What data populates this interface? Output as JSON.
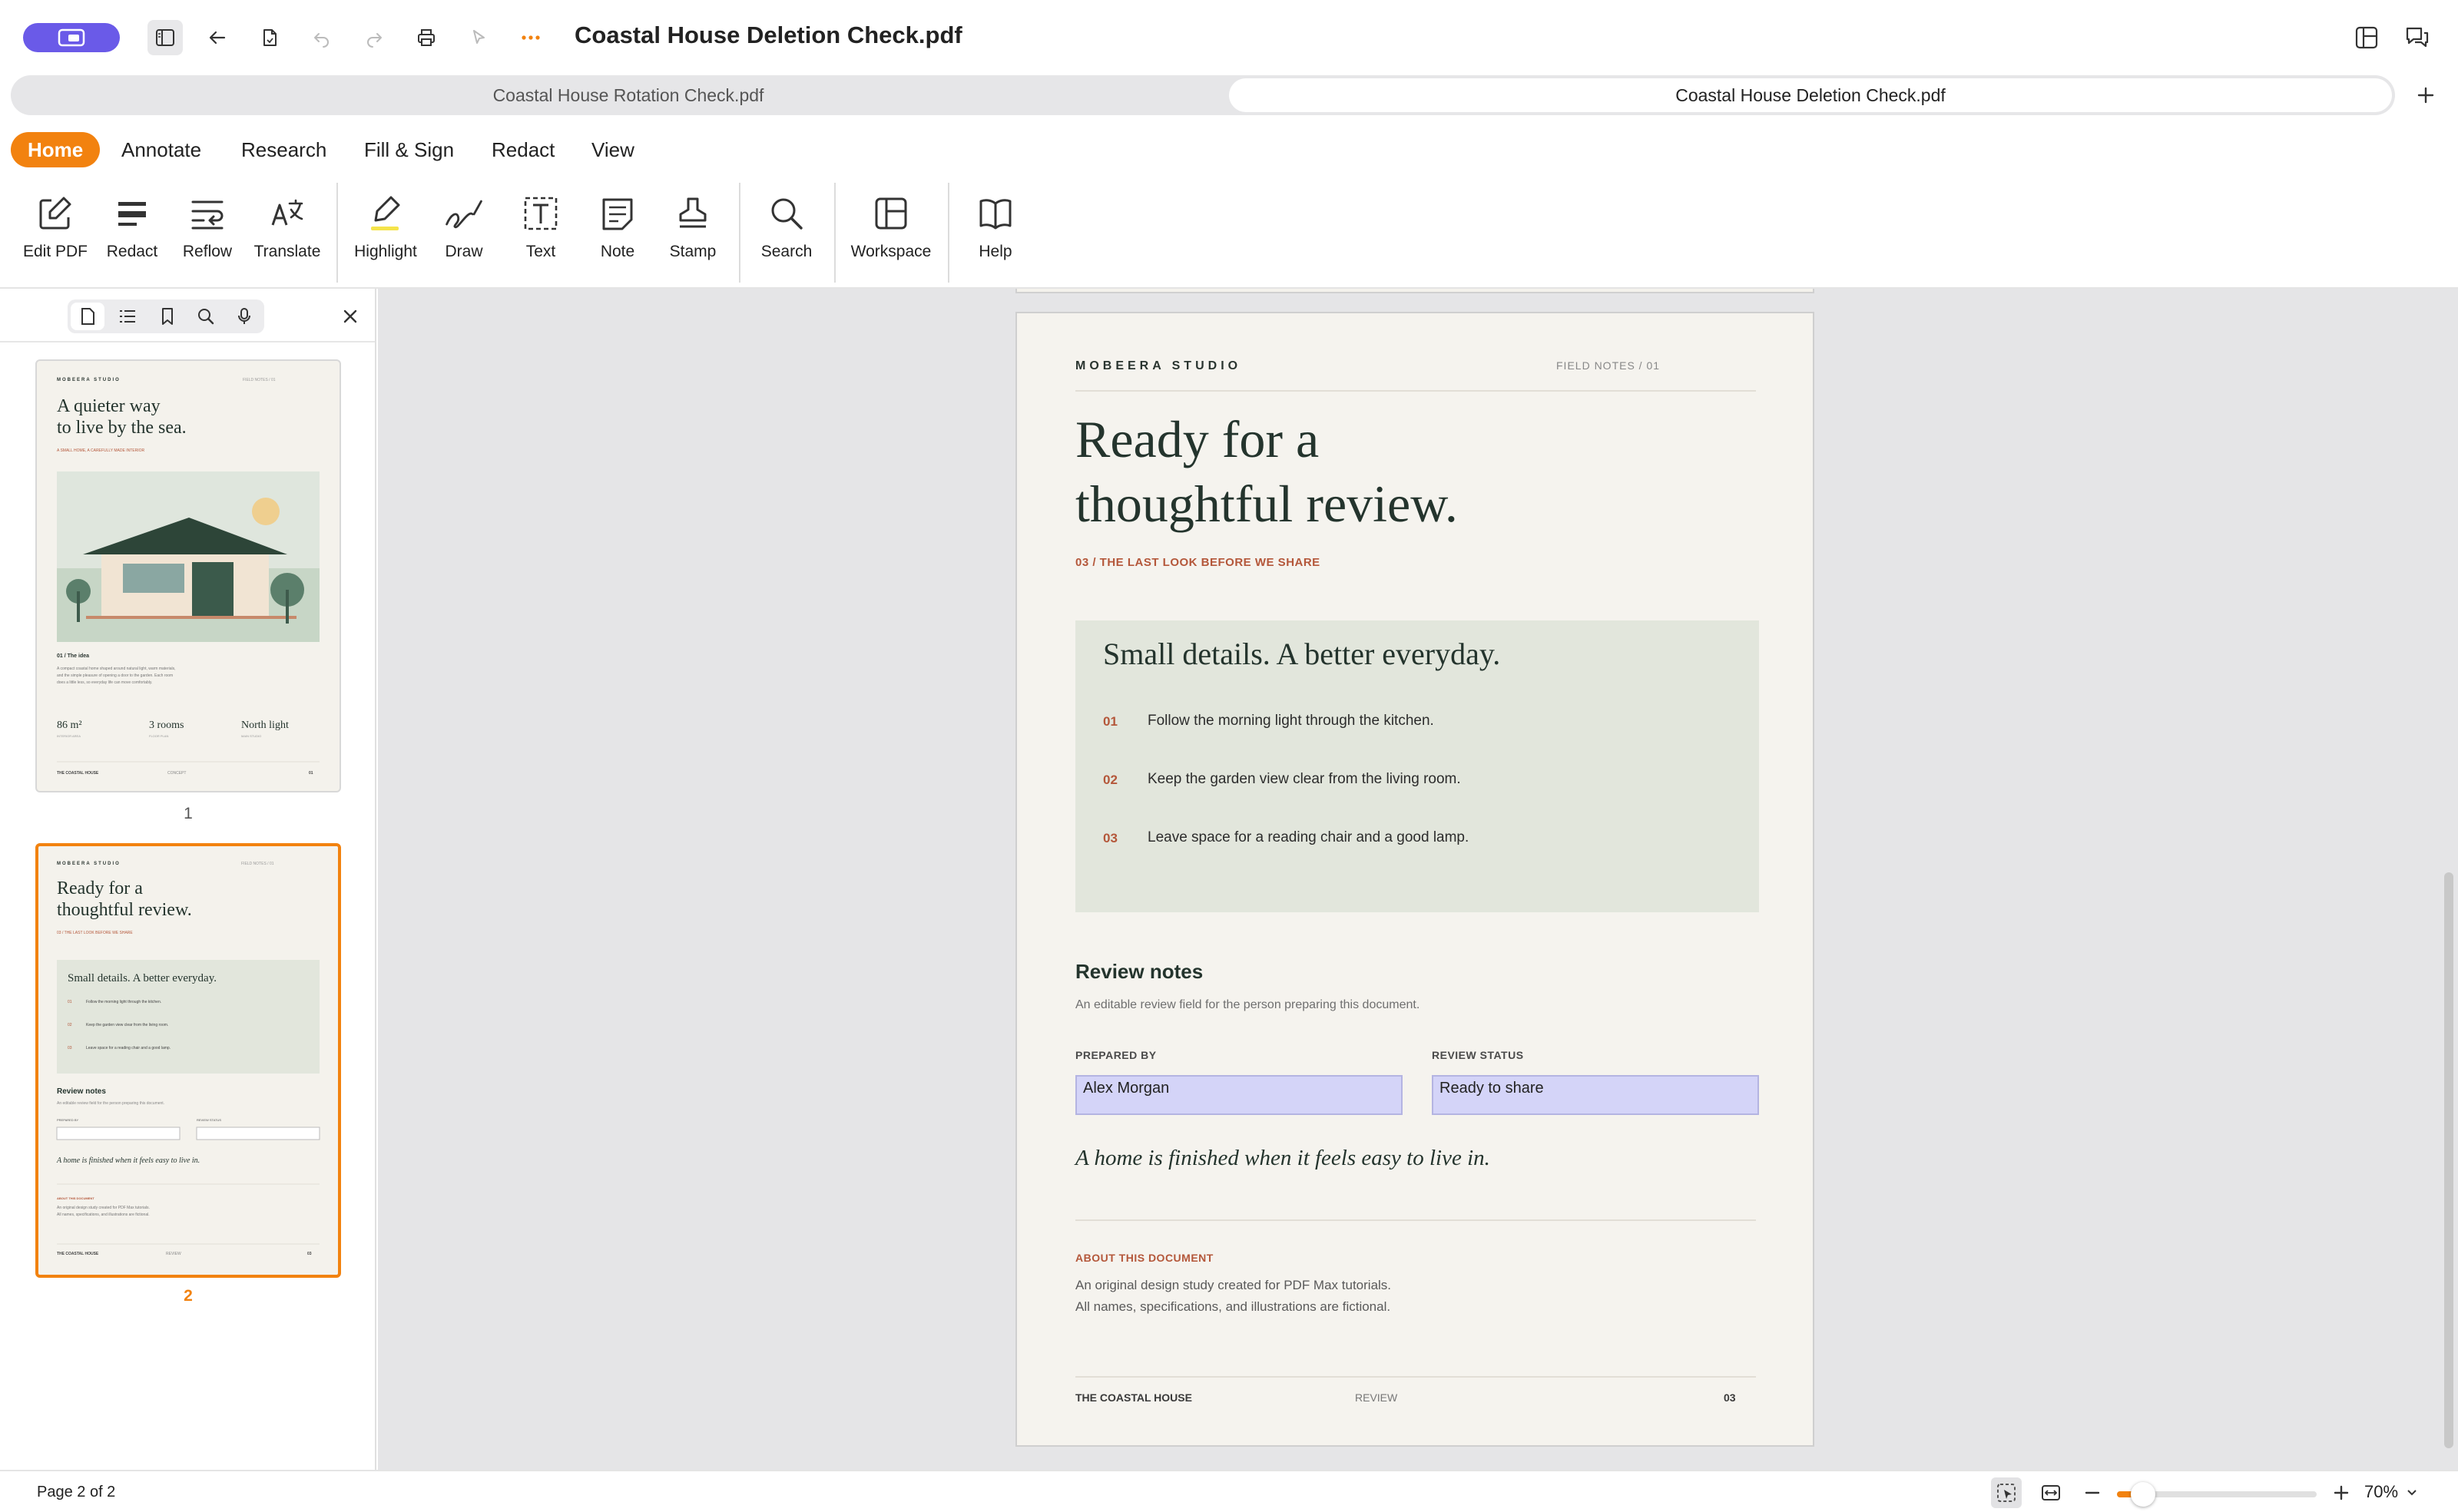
{
  "window": {
    "title": "Coastal House Deletion Check.pdf"
  },
  "tabs": [
    {
      "label": "Coastal House Rotation Check.pdf",
      "active": false
    },
    {
      "label": "Coastal House Deletion Check.pdf",
      "active": true
    }
  ],
  "menu": [
    "Home",
    "Annotate",
    "Research",
    "Fill & Sign",
    "Redact",
    "View"
  ],
  "menu_active": "Home",
  "toolbar": {
    "edit_pdf": "Edit PDF",
    "redact": "Redact",
    "reflow": "Reflow",
    "translate": "Translate",
    "highlight": "Highlight",
    "draw": "Draw",
    "text": "Text",
    "note": "Note",
    "stamp": "Stamp",
    "search": "Search",
    "workspace": "Workspace",
    "help": "Help"
  },
  "colors": {
    "accent": "#f2820f",
    "app_pill": "#6a5ae8",
    "brand_red": "#b4573a",
    "dark_green": "#24342d",
    "field_fill": "#d4d4f8"
  },
  "sidebar": {
    "thumbnails": [
      {
        "page_number": "1",
        "selected": false,
        "brand": "MOBEERA STUDIO",
        "notes": "FIELD NOTES / 01",
        "title_line1": "A quieter way",
        "title_line2": "to live by the sea.",
        "kicker": "A SMALL HOME, A CAREFULLY MADE INTERIOR",
        "section": "01 / The idea",
        "body_line1": "A compact coastal home shaped around natural light, warm materials,",
        "body_line2": "and the simple pleasure of opening a door to the garden. Each room",
        "body_line3": "does a little less, so everyday life can move comfortably.",
        "stats": [
          {
            "value": "86 m²",
            "label": "INTERIOR AREA"
          },
          {
            "value": "3 rooms",
            "label": "FLOOR PLAN"
          },
          {
            "value": "North light",
            "label": "MAIN STUDIO"
          }
        ],
        "footer_left": "THE COASTAL HOUSE",
        "footer_mid": "CONCEPT",
        "footer_right": "01"
      },
      {
        "page_number": "2",
        "selected": true,
        "brand": "MOBEERA STUDIO",
        "notes": "FIELD NOTES / 01",
        "title_line1": "Ready for a",
        "title_line2": "thoughtful review.",
        "kicker": "03 / THE LAST LOOK BEFORE WE SHARE",
        "box_title": "Small details. A better everyday.",
        "items": [
          "Follow the morning light through the kitchen.",
          "Keep the garden view clear from the living room.",
          "Leave space for a reading chair and a good lamp."
        ],
        "review_heading": "Review notes",
        "review_sub": "An editable review field for the person preparing this document.",
        "label_prepared": "PREPARED BY",
        "label_status": "REVIEW STATUS",
        "quote": "A home is finished when it feels easy to live in.",
        "about_label": "ABOUT THIS DOCUMENT",
        "about_line1": "An original design study created for PDF Max tutorials.",
        "about_line2": "All names, specifications, and illustrations are fictional.",
        "footer_left": "THE COASTAL HOUSE",
        "footer_mid": "REVIEW",
        "footer_right": "03"
      }
    ]
  },
  "page": {
    "brand": "MOBEERA STUDIO",
    "field_notes": "FIELD NOTES  /  01",
    "title_line1": "Ready for a",
    "title_line2": "thoughtful review.",
    "kicker": "03 / THE LAST LOOK BEFORE WE SHARE",
    "box_title": "Small details. A better everyday.",
    "items": [
      {
        "num": "01",
        "text": "Follow the morning light through the kitchen."
      },
      {
        "num": "02",
        "text": "Keep the garden view clear from the living room."
      },
      {
        "num": "03",
        "text": "Leave space for a reading chair and a good lamp."
      }
    ],
    "review_heading": "Review notes",
    "review_sub": "An editable review field for the person preparing this document.",
    "prepared_by_label": "PREPARED BY",
    "prepared_by_value": "Alex Morgan",
    "review_status_label": "REVIEW STATUS",
    "review_status_value": "Ready to share",
    "quote": "A home is finished when it feels easy to live in.",
    "about_label": "ABOUT THIS DOCUMENT",
    "about_line1": "An original design study created for PDF Max tutorials.",
    "about_line2": "All names, specifications, and illustrations are fictional.",
    "footer_left": "THE COASTAL HOUSE",
    "footer_mid": "REVIEW",
    "footer_right": "03"
  },
  "status": {
    "page_indicator": "Page 2 of 2",
    "zoom": "70%",
    "zoom_fraction": 0.07
  }
}
